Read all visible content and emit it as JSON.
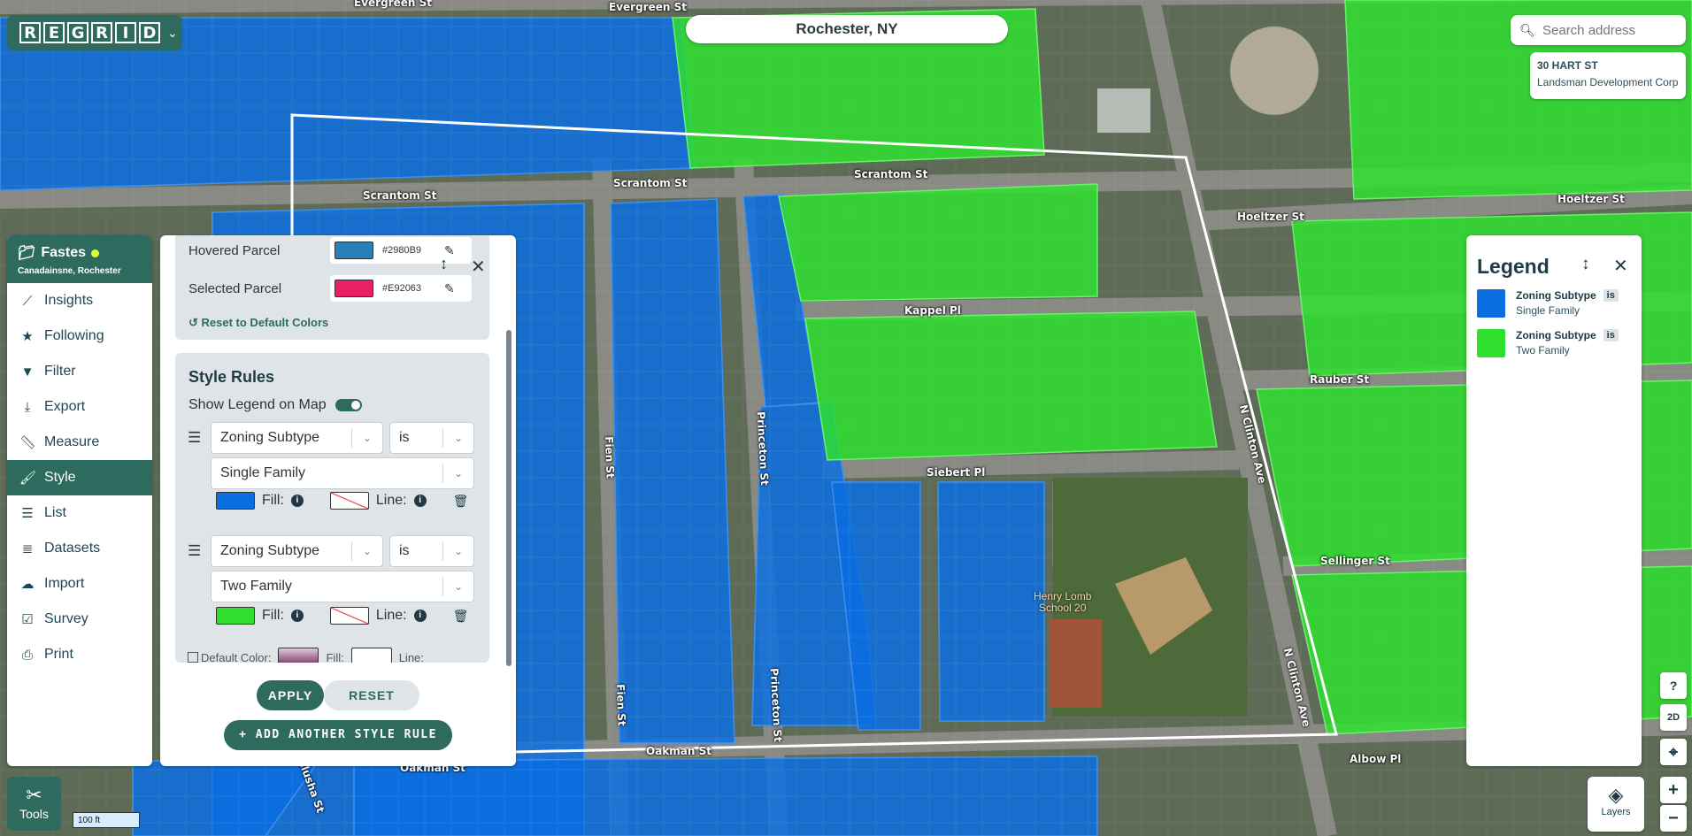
{
  "app": {
    "logo_letters": [
      "R",
      "E",
      "G",
      "R",
      "I",
      "D"
    ]
  },
  "map": {
    "city": "Rochester, NY",
    "streets": [
      "Evergreen St",
      "Evergreen St",
      "Scrantom St",
      "Scrantom St",
      "Scrantom St",
      "Hoeltzer St",
      "Hoeltzer St",
      "Kappel Pl",
      "Rauber St",
      "Siebert Pl",
      "Sellinger St",
      "Albow Pl",
      "Fien St",
      "Fien St",
      "Princeton St",
      "Princeton St",
      "N Clinton Ave",
      "N Clinton Ave",
      "Oakman St",
      "Oakman St",
      "Islusha St"
    ],
    "poi": "Henry Lomb\nSchool 20",
    "scale": "100 ft",
    "fill_single": "#0a6fe0",
    "fill_two": "#2fe02f"
  },
  "search": {
    "placeholder": "Search address"
  },
  "address_card": {
    "line1": "30 HART ST",
    "line2": "Landsman Development Corp"
  },
  "project": {
    "name": "Fastes",
    "location": "Canadainsne, Rochester"
  },
  "nav": [
    {
      "label": "Insights",
      "icon": "📈"
    },
    {
      "label": "Following",
      "icon": "★"
    },
    {
      "label": "Filter",
      "icon": "▼"
    },
    {
      "label": "Export",
      "icon": "⤓"
    },
    {
      "label": "Measure",
      "icon": "📐"
    },
    {
      "label": "Style",
      "icon": "🖌"
    },
    {
      "label": "List",
      "icon": "☰"
    },
    {
      "label": "Datasets",
      "icon": "🗄"
    },
    {
      "label": "Import",
      "icon": "☁"
    },
    {
      "label": "Survey",
      "icon": "☑"
    },
    {
      "label": "Print",
      "icon": "🖨"
    }
  ],
  "style_panel": {
    "hovered_label": "Hovered Parcel",
    "hovered_hex": "#2980B9",
    "selected_label": "Selected Parcel",
    "selected_hex": "#E92063",
    "reset_colors": "Reset to Default Colors",
    "rules_title": "Style Rules",
    "show_legend": "Show Legend on Map",
    "rules": [
      {
        "field": "Zoning Subtype",
        "operator": "is",
        "value": "Single Family",
        "fill_label": "Fill:",
        "line_label": "Line:",
        "fill_color": "#0a6fe0"
      },
      {
        "field": "Zoning Subtype",
        "operator": "is",
        "value": "Two Family",
        "fill_label": "Fill:",
        "line_label": "Line:",
        "fill_color": "#2fe02f"
      }
    ],
    "default_color": "Default Color:",
    "default_fill": "Fill:",
    "default_line": "Line:",
    "apply": "APPLY",
    "reset": "RESET",
    "add_rule": "+ ADD ANOTHER STYLE RULE"
  },
  "legend": {
    "title": "Legend",
    "items": [
      {
        "field": "Zoning Subtype",
        "op": "is",
        "value": "Single Family",
        "color": "#0a6fe0"
      },
      {
        "field": "Zoning Subtype",
        "op": "is",
        "value": "Two Family",
        "color": "#2fe02f"
      }
    ]
  },
  "controls": {
    "tools": "Tools",
    "layers": "Layers",
    "help": "?",
    "view_mode": "2D",
    "locate": "⌖",
    "zoom_in": "+",
    "zoom_out": "−"
  }
}
